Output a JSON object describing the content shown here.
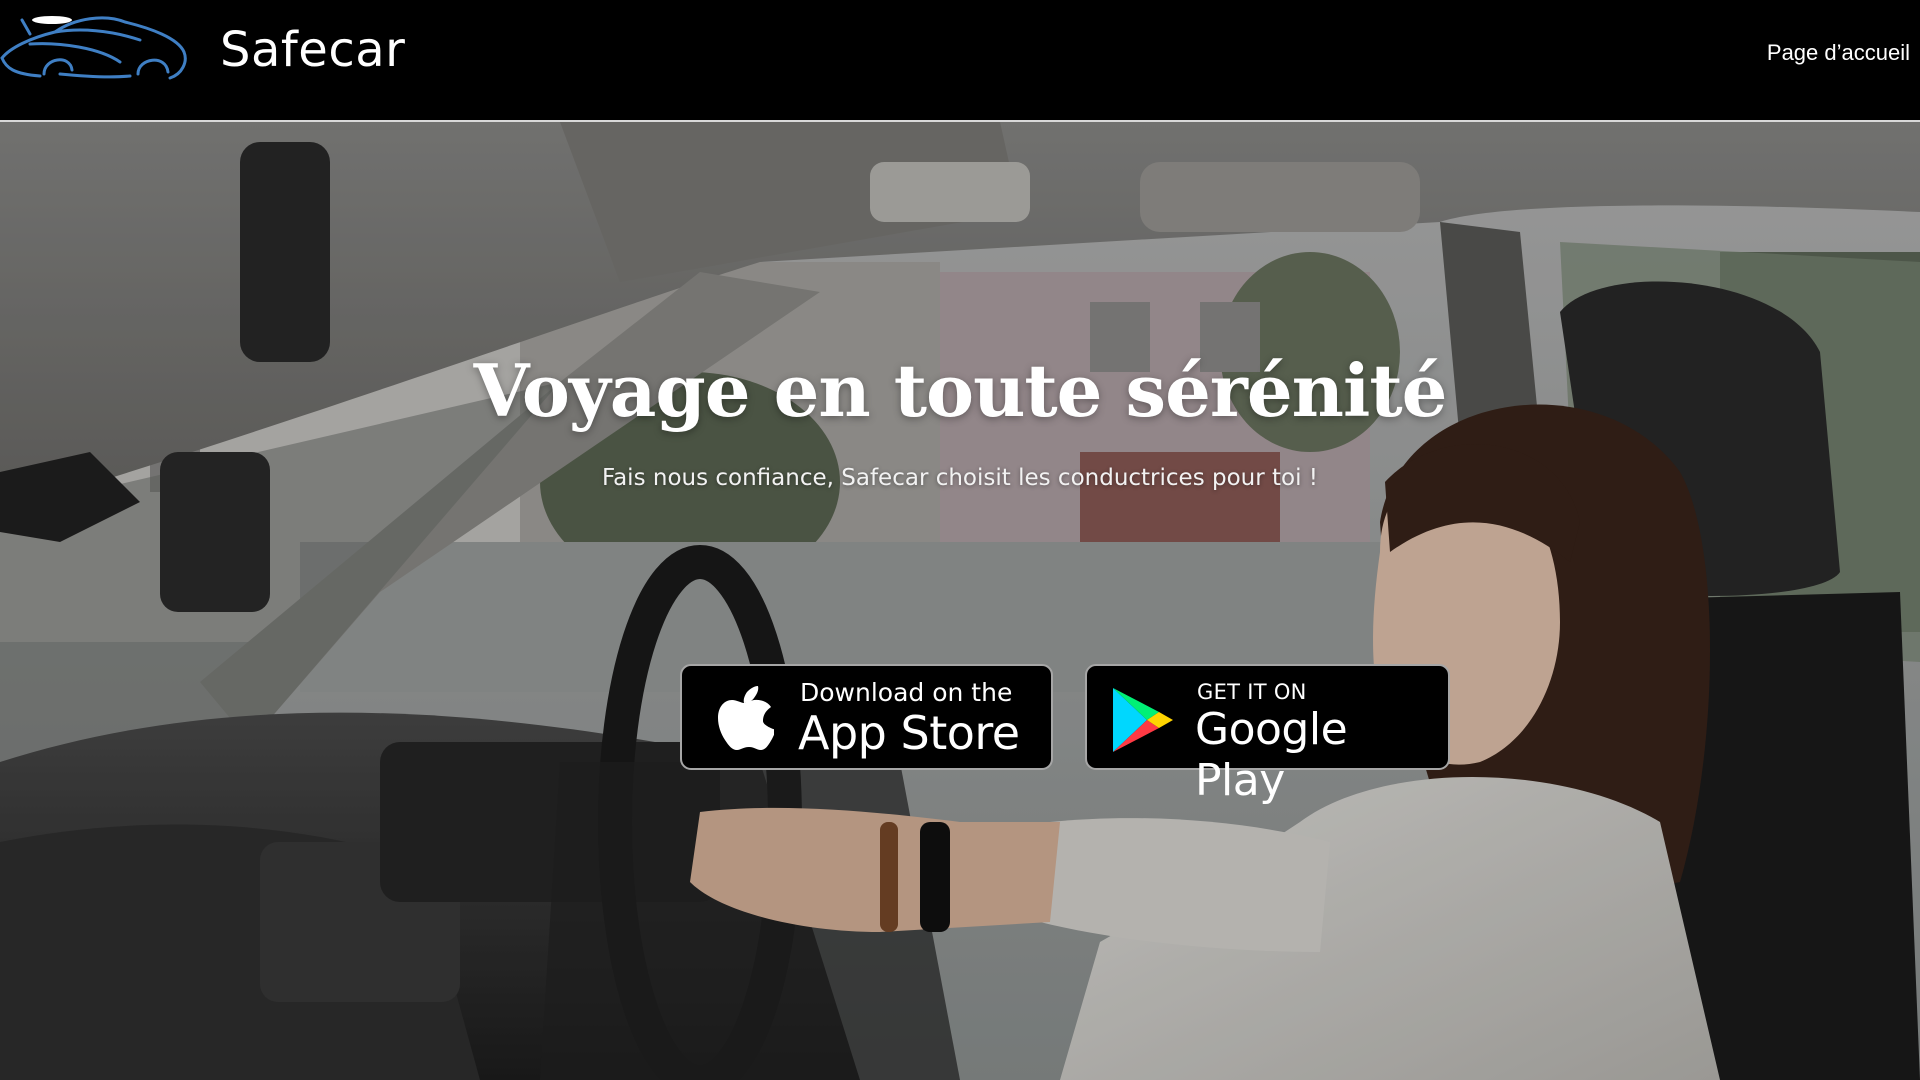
{
  "header": {
    "brand_name": "Safecar",
    "nav_link": "Page d’accueil"
  },
  "hero": {
    "title": "Voyage en toute sérénité",
    "subtitle": "Fais nous confiance, Safecar choisit les conductrices pour toi !"
  },
  "badges": {
    "apple": {
      "small_text": "Download on the",
      "big_text": "App Store",
      "icon": "apple-icon"
    },
    "google": {
      "small_text": "GET IT ON",
      "big_text": "Google Play",
      "icon": "google-play-icon"
    }
  },
  "colors": {
    "header_bg": "#000000",
    "logo_stroke": "#3f7fc4",
    "badge_border": "#a6a6a6"
  }
}
